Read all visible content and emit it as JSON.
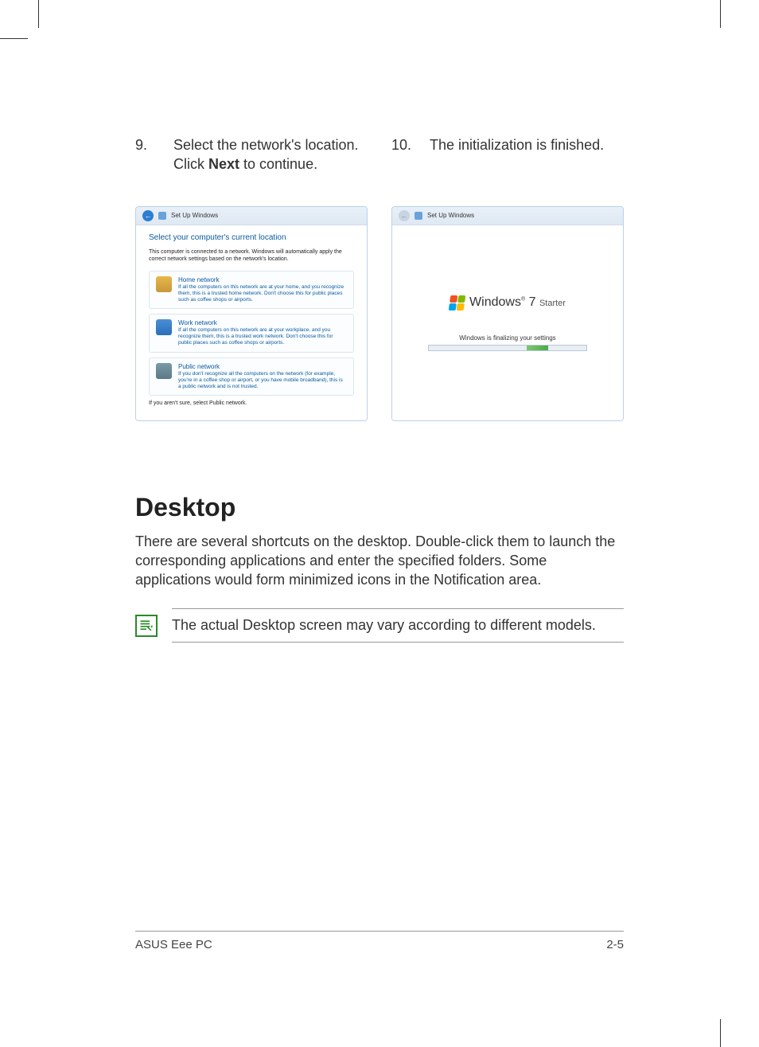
{
  "steps": {
    "s9": {
      "num": "9.",
      "text_a": "Select the network's location. Click ",
      "text_bold": "Next",
      "text_b": " to continue."
    },
    "s10": {
      "num": "10.",
      "text": "The initialization is finished."
    }
  },
  "win_left": {
    "title": "Set Up Windows",
    "heading": "Select your computer's current location",
    "intro": "This computer is connected to a network. Windows will automatically apply the correct network settings based on the network's location.",
    "options": {
      "home": {
        "title": "Home network",
        "desc": "If all the computers on this network are at your home, and you recognize them, this is a trusted home network. Don't choose this for public places such as coffee shops or airports."
      },
      "work": {
        "title": "Work network",
        "desc": "If all the computers on this network are at your workplace, and you recognize them, this is a trusted work network. Don't choose this for public places such as coffee shops or airports."
      },
      "public": {
        "title": "Public network",
        "desc": "If you don't recognize all the computers on the network (for example, you're in a coffee shop or airport, or you have mobile broadband), this is a public network and is not trusted."
      }
    },
    "foot": "If you aren't sure, select Public network."
  },
  "win_right": {
    "title": "Set Up Windows",
    "logo_main": "Windows",
    "logo_seven": "7",
    "logo_edition": "Starter",
    "finalizing": "Windows is finalizing your settings"
  },
  "desktop": {
    "heading": "Desktop",
    "text": "There are several shortcuts on the desktop. Double-click them to launch the corresponding applications and enter the specified folders. Some applications would form minimized icons in the Notification area.",
    "note": "The actual Desktop screen may vary according to different models."
  },
  "footer": {
    "left": "ASUS Eee PC",
    "right": "2-5"
  }
}
